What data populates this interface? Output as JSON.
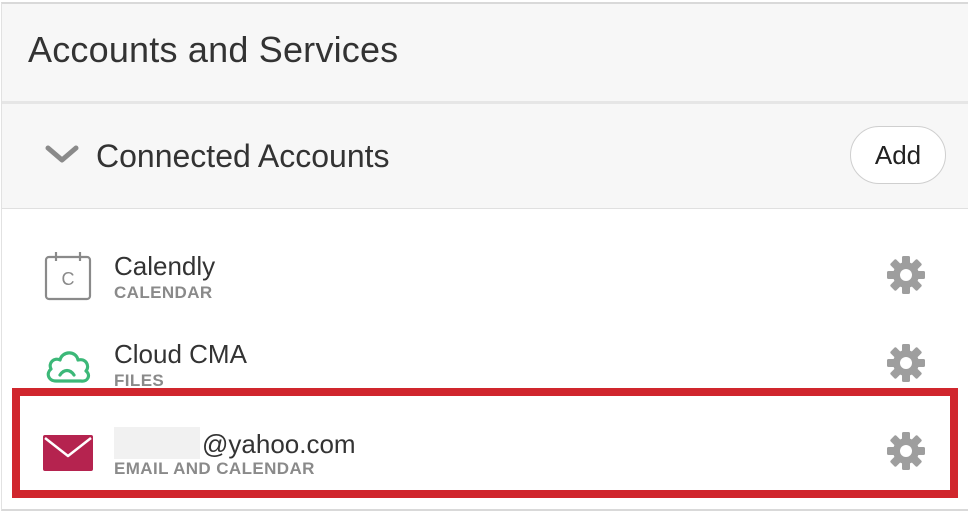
{
  "page": {
    "title": "Accounts and Services"
  },
  "section": {
    "title": "Connected Accounts",
    "add_label": "Add"
  },
  "accounts": [
    {
      "name": "Calendly",
      "type": "CALENDAR",
      "icon": "calendar-icon"
    },
    {
      "name": "Cloud CMA",
      "type": "FILES",
      "icon": "cloud-icon"
    },
    {
      "name": "@yahoo.com",
      "type": "EMAIL AND CALENDAR",
      "icon": "mail-icon"
    }
  ],
  "colors": {
    "header_bg": "#f7f7f7",
    "highlight": "#d0262d",
    "gear": "#9e9e9e",
    "cloud": "#3cb878",
    "mail": "#b5234f",
    "subtext": "#8a8a8a"
  }
}
